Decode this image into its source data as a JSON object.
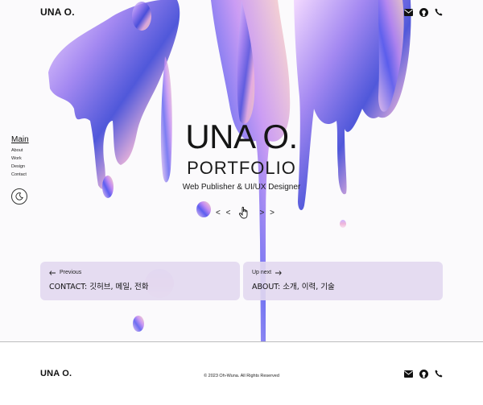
{
  "header": {
    "brand": "UNA O.",
    "icons": [
      "mail-icon",
      "github-icon",
      "phone-icon"
    ]
  },
  "sidenav": {
    "main": "Main",
    "items": [
      "About",
      "Work",
      "Design",
      "Contact"
    ],
    "theme_icon": "moon-icon"
  },
  "hero": {
    "title": "UNA O.",
    "subtitle": "PORTFOLIO",
    "tagline": "Web Publisher & UI/UX Designer",
    "arrows_left": "< <",
    "arrows_right": "> >",
    "hint_icon": "hand-pointer-icon"
  },
  "cards": {
    "prev": {
      "label": "Previous",
      "desc": "CONTACT: 깃허브, 메일, 전화"
    },
    "next": {
      "label": "Up next",
      "desc": "ABOUT: 소개, 이력, 기술"
    }
  },
  "footer": {
    "brand": "UNA O.",
    "copyright": "© 2023 Oh-Wuna. All Rights Reserved"
  },
  "colors": {
    "card_bg": "#e2d8f0",
    "accent_purple": "#8a6bd8",
    "text": "#111111"
  }
}
